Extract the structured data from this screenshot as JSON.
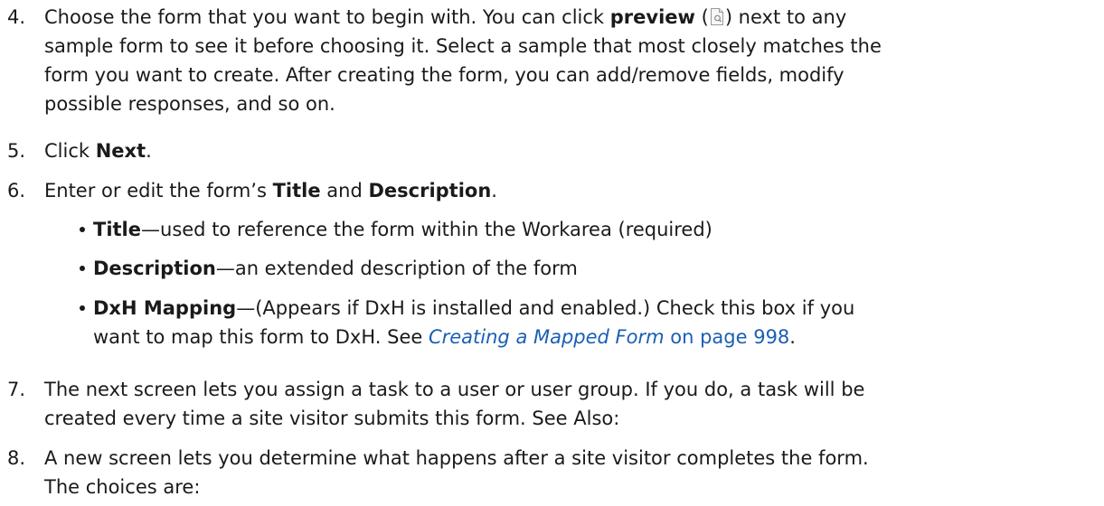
{
  "steps": [
    {
      "num": "4.",
      "lines": [
        {
          "a": "Choose the form that you want to begin with. You can click ",
          "b": "preview",
          "c": " (",
          "d": ") next to any"
        },
        {
          "text": "sample form to see it before choosing it. Select a sample that most closely matches the"
        },
        {
          "text": "form you want to create. After creating the form, you can add/remove fields, modify"
        },
        {
          "text": "possible responses, and so on."
        }
      ]
    },
    {
      "num": "5.",
      "pre": "Click ",
      "bold": "Next",
      "post": "."
    },
    {
      "num": "6.",
      "pre": "Enter or edit the form’s ",
      "bold1": "Title",
      "mid": " and ",
      "bold2": "Description",
      "post": "."
    },
    {
      "num": "7.",
      "lines": [
        {
          "text": "The next screen lets you assign a task to a user or user group. If you do, a task will be"
        },
        {
          "text": "created every time a site visitor submits this form. See Also:"
        }
      ]
    },
    {
      "num": "8.",
      "lines": [
        {
          "text": "A new screen lets you determine what happens after a site visitor completes the form."
        },
        {
          "text": "The choices are:"
        }
      ]
    }
  ],
  "bullets": [
    {
      "term": "Title",
      "text": "—used to reference the form within the Workarea (required)"
    },
    {
      "term": "Description",
      "text": "—an extended description of the form"
    },
    {
      "term": "DxH Mapping",
      "text": "—(Appears if DxH is installed and enabled.) Check this box if you",
      "line2_pre": "want to map this form to DxH. See ",
      "link_title": "Creating a Mapped Form",
      "link_page": " on page 998",
      "line2_post": "."
    }
  ],
  "icons": {
    "preview": "preview-page-icon"
  },
  "colors": {
    "text": "#1a1a1a",
    "link": "#1a5fb4"
  }
}
